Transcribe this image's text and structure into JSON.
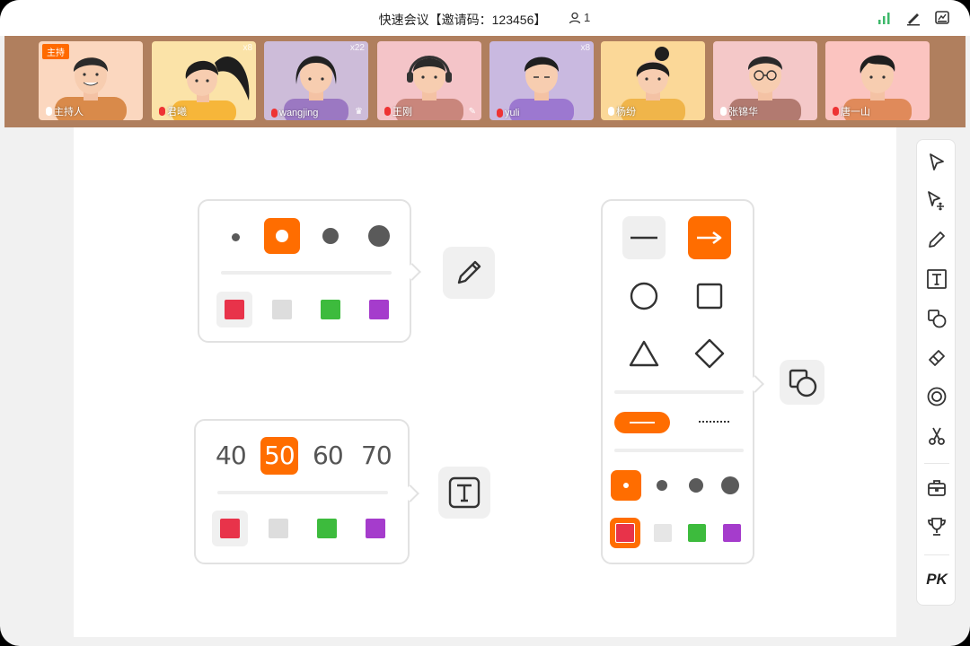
{
  "topbar": {
    "title": "快速会议【邀请码：123456】",
    "people_count": "1",
    "icons": [
      "signal-icon",
      "edit-icon",
      "whiteboard-icon"
    ]
  },
  "participants": [
    {
      "name": "主持人",
      "host_badge": "主持",
      "likes": "",
      "mic": "on"
    },
    {
      "name": "君曦",
      "host_badge": "",
      "likes": "x8",
      "mic": "off"
    },
    {
      "name": "wangjing",
      "host_badge": "",
      "likes": "x22",
      "mic": "off",
      "corner": "♛"
    },
    {
      "name": "王刚",
      "host_badge": "",
      "likes": "",
      "mic": "off",
      "corner": "✎"
    },
    {
      "name": "yuli",
      "host_badge": "",
      "likes": "x8",
      "mic": "off"
    },
    {
      "name": "杨纷",
      "host_badge": "",
      "likes": "",
      "mic": "on"
    },
    {
      "name": "张锦华",
      "host_badge": "",
      "likes": "",
      "mic": "on"
    },
    {
      "name": "唐一山",
      "host_badge": "",
      "likes": "",
      "mic": "off"
    }
  ],
  "pen_popup": {
    "stroke_sizes": [
      "small",
      "medium-selected",
      "large",
      "xlarge"
    ],
    "colors": [
      "#e8334a",
      "#dddddd",
      "#3dbb3d",
      "#a53ccc"
    ],
    "selected_color": "#e8334a"
  },
  "text_popup": {
    "font_sizes": [
      "40",
      "50",
      "60",
      "70"
    ],
    "selected_font_size": "50",
    "colors": [
      "#e8334a",
      "#dddddd",
      "#3dbb3d",
      "#a53ccc"
    ]
  },
  "shape_popup": {
    "shapes": [
      "line",
      "arrow-selected",
      "circle",
      "square",
      "triangle",
      "diamond"
    ],
    "line_styles": [
      "solid-selected",
      "dotted"
    ],
    "stroke_sizes": [
      "small-selected",
      "medium",
      "large",
      "xlarge"
    ],
    "colors": [
      "#e8334a",
      "#e6e6e6",
      "#3dbb3d",
      "#a53ccc"
    ]
  },
  "toolbar": {
    "tools": [
      "select",
      "move-select",
      "pen",
      "text",
      "shapes",
      "eraser",
      "laser",
      "scissors",
      "toolbox",
      "trophy"
    ],
    "pk_label": "PK"
  },
  "colors": {
    "accent": "#ff6d00",
    "strip_bg": "#b07f5e"
  }
}
